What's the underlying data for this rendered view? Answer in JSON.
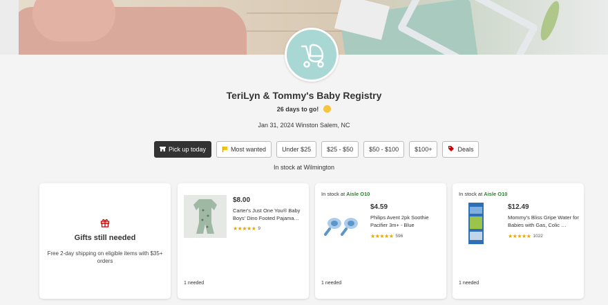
{
  "registry": {
    "title": "TeriLyn & Tommy's Baby Registry",
    "countdown": "26 days to go!",
    "event": "Jan 31, 2024 Winston Salem, NC",
    "stock_location": "In stock at Wilmington"
  },
  "filters": [
    {
      "label": "Pick up today",
      "icon": "store-icon",
      "active": true
    },
    {
      "label": "Most wanted",
      "icon": "flag-icon"
    },
    {
      "label": "Under $25"
    },
    {
      "label": "$25 - $50"
    },
    {
      "label": "$50 - $100"
    },
    {
      "label": "$100+"
    },
    {
      "label": "Deals",
      "icon": "tag-icon"
    }
  ],
  "gift_card": {
    "title": "Gifts still needed",
    "text": "Free 2-day shipping on eligible items with $35+ orders"
  },
  "products": [
    {
      "instock_prefix": "",
      "aisle": "",
      "price": "$8.00",
      "name": "Carter's Just One You® Baby Boys' Dino Footed Pajama…",
      "stars": 4.5,
      "rating_count": "9",
      "needed": "1 needed"
    },
    {
      "instock_prefix": "In stock at",
      "aisle": "Aisle O10",
      "price": "$4.59",
      "name": "Philips Avent 2pk Soothie Pacifier 3m+ - Blue",
      "stars": 4.5,
      "rating_count": "596",
      "needed": "1 needed"
    },
    {
      "instock_prefix": "In stock at",
      "aisle": "Aisle O10",
      "price": "$12.49",
      "name": "Mommy's Bliss Gripe Water for Babies with Gas, Colic …",
      "stars": 4.5,
      "rating_count": "1022",
      "needed": "1 needed"
    }
  ],
  "colors": {
    "accent_green": "#2e7d32",
    "star": "#e6a700",
    "avatar_bg": "#a9d7d3",
    "active_chip": "#333333"
  }
}
